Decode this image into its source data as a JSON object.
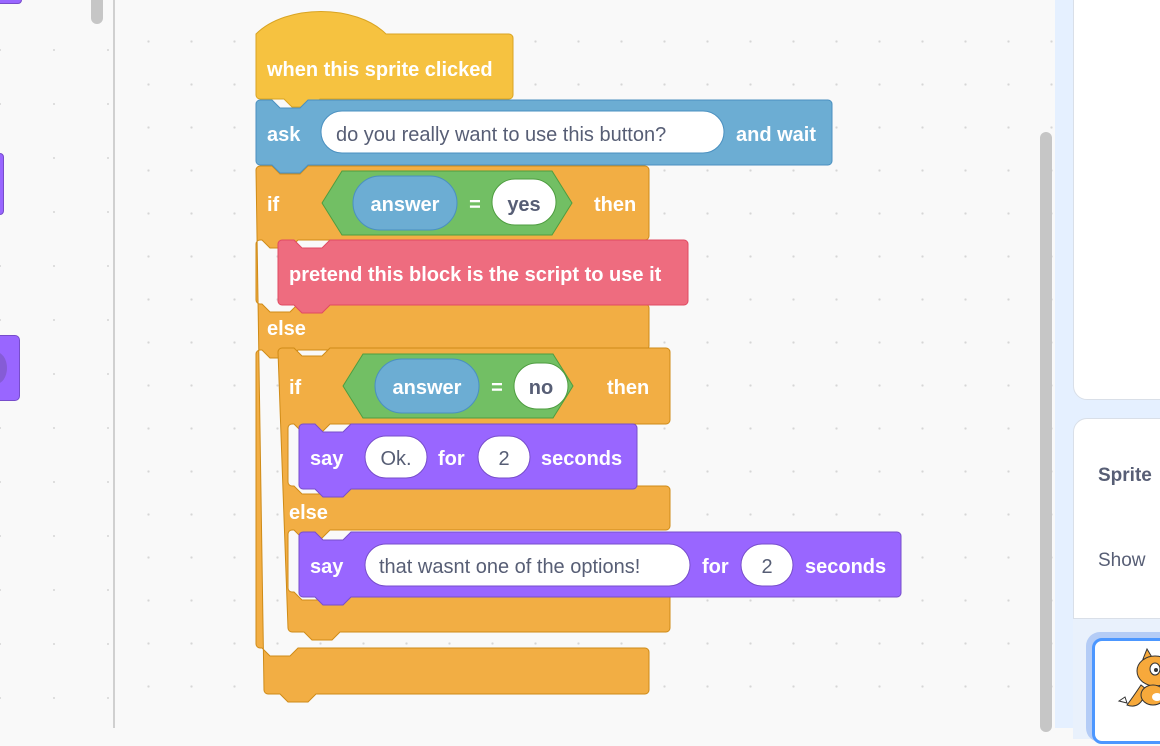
{
  "colors": {
    "events": "#f6c240",
    "sensing": "#6cadd3",
    "control": "#f2ae44",
    "operators": "#72bf64",
    "custom": "#ee6c7f",
    "looks": "#9966ff",
    "input_text": "#575e75"
  },
  "script": {
    "hat": {
      "label": "when this sprite clicked"
    },
    "ask": {
      "label": "ask",
      "input": "do you really want to use this button?",
      "suffix": "and wait"
    },
    "if1": {
      "if_label": "if",
      "condition": {
        "reporter": "answer",
        "op": "=",
        "value": "yes"
      },
      "then_label": "then",
      "body": {
        "label": "pretend this block is the script to use it"
      },
      "else_label": "else"
    },
    "if2": {
      "if_label": "if",
      "condition": {
        "reporter": "answer",
        "op": "=",
        "value": "no"
      },
      "then_label": "then",
      "say1": {
        "label": "say",
        "message": "Ok.",
        "for_label": "for",
        "secs": "2",
        "seconds_label": "seconds"
      },
      "else_label": "else",
      "say2": {
        "label": "say",
        "message": "that wasnt one of the options!",
        "for_label": "for",
        "secs": "2",
        "seconds_label": "seconds"
      }
    }
  },
  "sprite_panel": {
    "sprite_label": "Sprite",
    "show_label": "Show"
  }
}
